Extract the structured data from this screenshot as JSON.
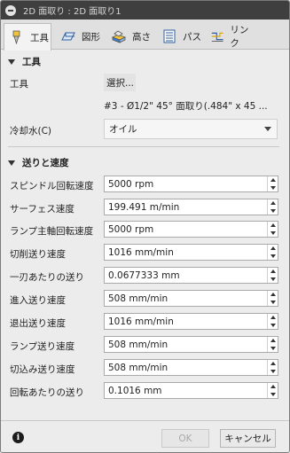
{
  "window": {
    "title": "2D 面取り : 2D 面取り1"
  },
  "tabs": [
    {
      "label": "工具",
      "icon": "tool-icon"
    },
    {
      "label": "図形",
      "icon": "geometry-icon"
    },
    {
      "label": "高さ",
      "icon": "heights-icon"
    },
    {
      "label": "パス",
      "icon": "passes-icon"
    },
    {
      "label": "リンク",
      "icon": "linking-icon"
    }
  ],
  "tool_section": {
    "header": "工具",
    "tool_label": "工具",
    "select_button": "選択...",
    "tool_description": "#3 - Ø1/2\" 45° 面取り(.484\" x 45 ...",
    "coolant_label": "冷却水(C)",
    "coolant_value": "オイル"
  },
  "feed_section": {
    "header": "送りと速度",
    "rows": [
      {
        "label": "スピンドル回転速度",
        "value": "5000 rpm"
      },
      {
        "label": "サーフェス速度",
        "value": "199.491 m/min"
      },
      {
        "label": "ランプ主軸回転速度",
        "value": "5000 rpm"
      },
      {
        "label": "切削送り速度",
        "value": "1016 mm/min"
      },
      {
        "label": "一刃あたりの送り",
        "value": "0.0677333 mm"
      },
      {
        "label": "進入送り速度",
        "value": "508 mm/min"
      },
      {
        "label": "退出送り速度",
        "value": "1016 mm/min"
      },
      {
        "label": "ランプ送り速度",
        "value": "508 mm/min"
      },
      {
        "label": "切込み送り速度",
        "value": "508 mm/min"
      },
      {
        "label": "回転あたりの送り",
        "value": "0.1016 mm"
      }
    ]
  },
  "footer": {
    "ok_label": "OK",
    "cancel_label": "キャンセル"
  }
}
